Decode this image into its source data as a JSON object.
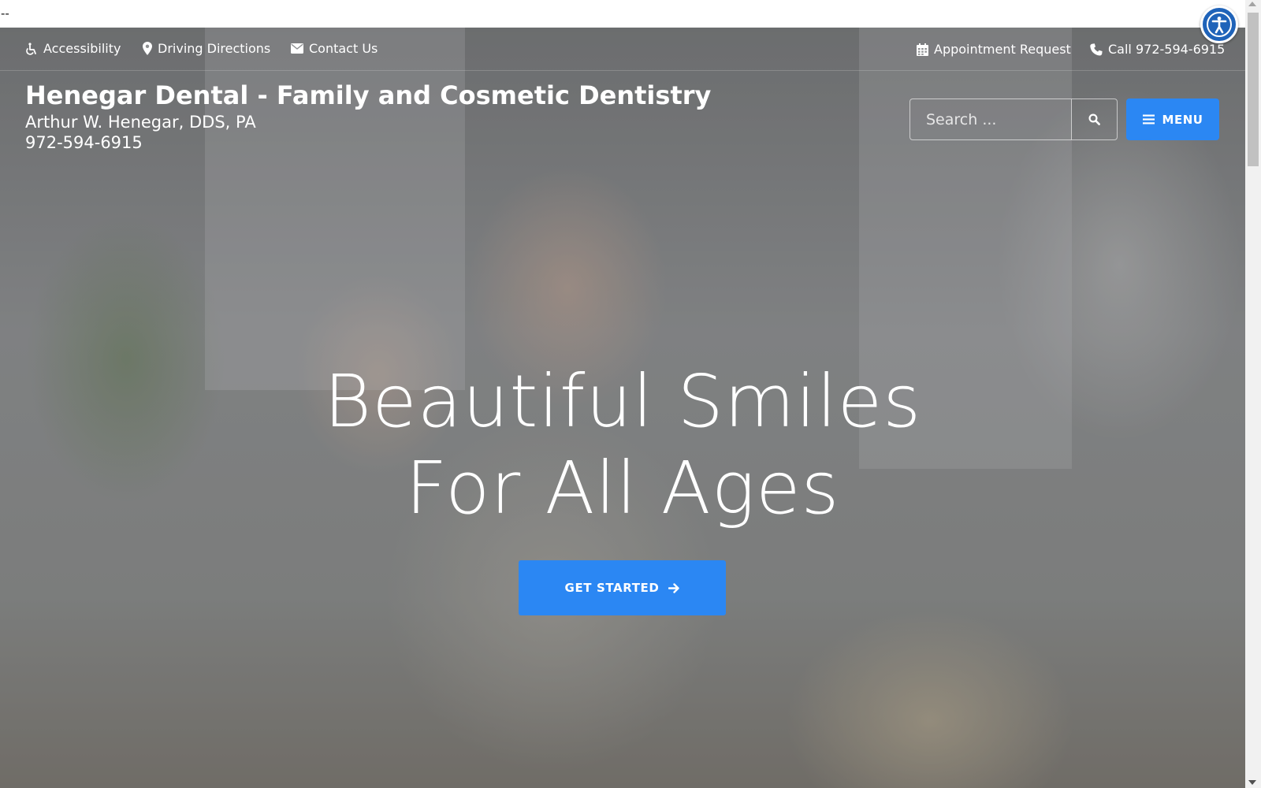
{
  "top_strip": {
    "text": "--"
  },
  "accessibility_widget": {
    "icon": "accessibility-person-icon"
  },
  "util_bar": {
    "left_links": [
      {
        "label": "Accessibility",
        "icon": "wheelchair-icon"
      },
      {
        "label": "Driving Directions",
        "icon": "map-marker-icon"
      },
      {
        "label": "Contact Us",
        "icon": "envelope-icon"
      }
    ],
    "right_links": [
      {
        "label": "Appointment Request",
        "icon": "calendar-icon"
      },
      {
        "label": "Call 972-594-6915",
        "icon": "phone-icon"
      }
    ]
  },
  "brand": {
    "title": "Henegar Dental - Family and Cosmetic Dentistry",
    "doctor": "Arthur W. Henegar, DDS, PA",
    "phone": "972-594-6915"
  },
  "search": {
    "placeholder": "Search ...",
    "icon": "search-icon"
  },
  "menu_button": {
    "label": "MENU",
    "icon": "hamburger-icon"
  },
  "hero": {
    "heading_line1": "Beautiful Smiles",
    "heading_line2": "For All Ages",
    "cta_label": "GET STARTED",
    "cta_icon": "arrow-right-icon"
  },
  "colors": {
    "accent": "#2b87f3",
    "a11y_widget": "#1f63b9",
    "text_on_hero": "#ffffff"
  }
}
